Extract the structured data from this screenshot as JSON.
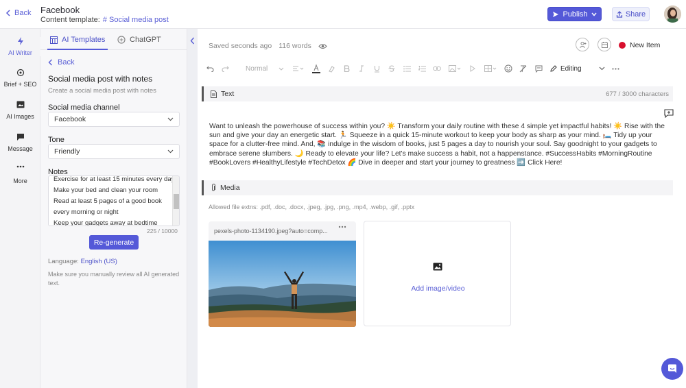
{
  "topbar": {
    "back_label": "Back",
    "doc_title": "Facebook",
    "template_prefix": "Content template:",
    "template_name": "# Social media post",
    "publish_label": "Publish",
    "share_label": "Share"
  },
  "rail": {
    "items": [
      {
        "label": "AI Writer",
        "icon": "lightning-icon"
      },
      {
        "label": "Brief + SEO",
        "icon": "target-icon"
      },
      {
        "label": "AI Images",
        "icon": "image-icon"
      },
      {
        "label": "Message",
        "icon": "message-icon"
      },
      {
        "label": "More",
        "icon": "more-icon"
      }
    ]
  },
  "panel": {
    "tabs": [
      {
        "label": "AI Templates"
      },
      {
        "label": "ChatGPT"
      }
    ],
    "back_label": "Back",
    "title": "Social media post with notes",
    "subtitle": "Create a social media post with notes",
    "channel": {
      "label": "Social media channel",
      "value": "Facebook"
    },
    "tone": {
      "label": "Tone",
      "value": "Friendly"
    },
    "notes": {
      "label": "Notes",
      "lines": [
        "Exercise for at least 15 minutes every day",
        "Make your bed and clean your room",
        "Read at least 5 pages of a good book",
        "every morning or night",
        "Keep your gadgets away at bedtime"
      ],
      "count": "225 / 10000"
    },
    "regenerate_label": "Re-generate",
    "language_prefix": "Language:",
    "language_value": "English (US)",
    "review_note": "Make sure you manually review all AI generated text."
  },
  "editor": {
    "saved_text": "Saved seconds ago",
    "word_count": "116 words",
    "status_label": "New Item",
    "status_color": "#d8102e",
    "toolbar": {
      "style_select": "Normal",
      "mode_label": "Editing"
    },
    "text_section": {
      "label": "Text",
      "char_count": "677 / 3000 characters",
      "body": "Want to unleash the powerhouse of success within you? ☀️ Transform your daily routine with these 4 simple yet impactful habits! ☀️ Rise with the sun and give your day an energetic start. 🏃 Squeeze in a quick 15-minute workout to keep your body as sharp as your mind. 🛏️ Tidy up your space for a clutter-free mind. And, 📚 indulge in the wisdom of books, just 5 pages a day to nourish your soul. Say goodnight to your gadgets to embrace serene slumbers. 🌙 Ready to elevate your life? Let's make success a habit, not a happenstance. #SuccessHabits #MorningRoutine #BookLovers #HealthyLifestyle #TechDetox 🌈 Dive in deeper and start your journey to greatness ➡️ Click Here!"
    },
    "media_section": {
      "label": "Media",
      "allowed": "Allowed file extns: .pdf, .doc, .docx, .jpeg, .jpg, .png, .mp4, .webp, .gif, .pptx",
      "file_name": "pexels-photo-1134190.jpeg?auto=comp...",
      "add_label": "Add image/video"
    }
  },
  "colors": {
    "accent": "#5459d8",
    "panel_bg": "#f7f7f9"
  }
}
